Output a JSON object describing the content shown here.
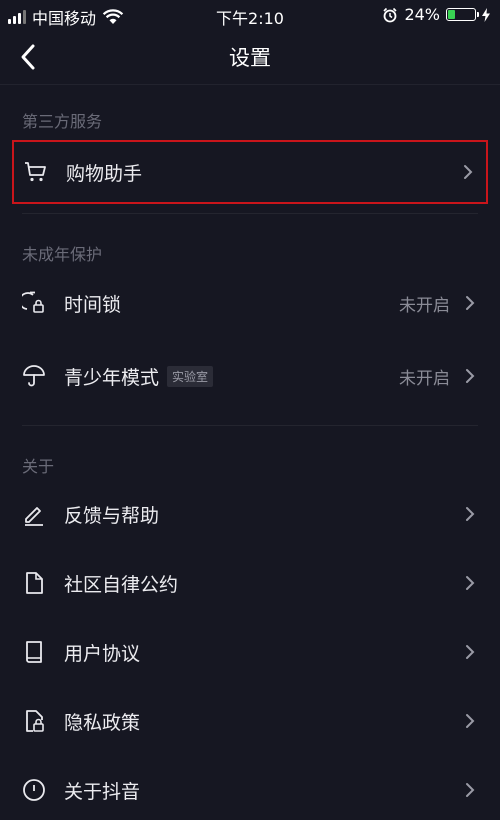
{
  "status_bar": {
    "carrier": "中国移动",
    "time": "下午2:10",
    "battery": "24%",
    "battery_level": 0.24
  },
  "nav": {
    "title": "设置"
  },
  "sections": [
    {
      "header": "第三方服务",
      "items": [
        {
          "label": "购物助手",
          "icon": "cart-icon"
        }
      ]
    },
    {
      "header": "未成年保护",
      "items": [
        {
          "label": "时间锁",
          "status": "未开启",
          "icon": "timelock-icon"
        },
        {
          "label": "青少年模式",
          "badge": "实验室",
          "status": "未开启",
          "icon": "umbrella-icon"
        }
      ]
    },
    {
      "header": "关于",
      "items": [
        {
          "label": "反馈与帮助",
          "icon": "pencil-icon"
        },
        {
          "label": "社区自律公约",
          "icon": "document-icon"
        },
        {
          "label": "用户协议",
          "icon": "book-icon"
        },
        {
          "label": "隐私政策",
          "icon": "lock-document-icon"
        },
        {
          "label": "关于抖音",
          "icon": "info-icon"
        }
      ]
    }
  ],
  "colors": {
    "background": "#161722",
    "highlight": "#c9151b",
    "battery": "#39d353"
  }
}
